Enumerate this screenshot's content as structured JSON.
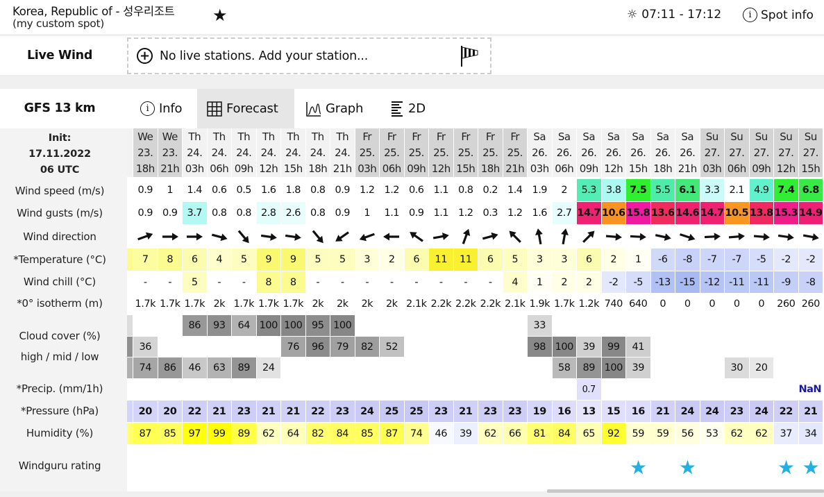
{
  "spot": {
    "title": "Korea, Republic of - 성우리조트",
    "subtitle": "(my custom spot)",
    "favorite_icon": "star-icon",
    "sun_times": "07:11 - 17:12",
    "spot_info": "Spot info"
  },
  "live_wind": {
    "label": "Live Wind",
    "message": "No live stations. Add your station..."
  },
  "model": {
    "name": "GFS 13 km"
  },
  "tabs": [
    {
      "label": "Info",
      "icon": "info-icon"
    },
    {
      "label": "Forecast",
      "icon": "grid-icon",
      "active": true
    },
    {
      "label": "Graph",
      "icon": "graph-icon"
    },
    {
      "label": "2D",
      "icon": "bars-icon"
    }
  ],
  "init": {
    "label": "Init:",
    "date": "17.11.2022",
    "time": "06 UTC"
  },
  "row_labels": {
    "wind_speed": "Wind speed (m/s)",
    "wind_gusts": "Wind gusts (m/s)",
    "wind_direction": "Wind direction",
    "temperature": "*Temperature (°C)",
    "wind_chill": "Wind chill (°C)",
    "isotherm": "*0° isotherm (m)",
    "cloud": "Cloud cover (%)",
    "cloud_sub": "high / mid / low",
    "precip": "*Precip. (mm/1h)",
    "pressure": "*Pressure (hPa)",
    "humidity": "Humidity (%)",
    "rating": "Windguru rating"
  },
  "columns": {
    "day": [
      "We",
      "We",
      "Th",
      "Th",
      "Th",
      "Th",
      "Th",
      "Th",
      "Th",
      "Fr",
      "Fr",
      "Fr",
      "Fr",
      "Fr",
      "Fr",
      "Fr",
      "Sa",
      "Sa",
      "Sa",
      "Sa",
      "Sa",
      "Sa",
      "Sa",
      "Su",
      "Su",
      "Su",
      "Su",
      "Su"
    ],
    "date": [
      "23.",
      "23.",
      "24.",
      "24.",
      "24.",
      "24.",
      "24.",
      "24.",
      "24.",
      "25.",
      "25.",
      "25.",
      "25.",
      "25.",
      "25.",
      "25.",
      "26.",
      "26.",
      "26.",
      "26.",
      "26.",
      "26.",
      "26.",
      "27.",
      "27.",
      "27.",
      "27.",
      "27."
    ],
    "hour": [
      "18h",
      "21h",
      "03h",
      "06h",
      "09h",
      "12h",
      "15h",
      "18h",
      "21h",
      "03h",
      "06h",
      "09h",
      "12h",
      "15h",
      "18h",
      "21h",
      "03h",
      "06h",
      "09h",
      "12h",
      "15h",
      "18h",
      "21h",
      "03h",
      "06h",
      "09h",
      "12h",
      "15h"
    ],
    "wind_speed": [
      "0.9",
      "1",
      "1.4",
      "0.6",
      "0.5",
      "1.6",
      "1.8",
      "0.8",
      "0.9",
      "1.2",
      "1.2",
      "0.6",
      "1.1",
      "0.8",
      "0.2",
      "1.4",
      "1.9",
      "2",
      "5.3",
      "3.8",
      "7.5",
      "5.5",
      "6.1",
      "3.3",
      "2.1",
      "4.9",
      "7.4",
      "6.8"
    ],
    "wind_gusts": [
      "0.9",
      "0.9",
      "3.7",
      "0.8",
      "0.8",
      "2.8",
      "2.6",
      "0.8",
      "0.9",
      "1",
      "1.1",
      "0.9",
      "1.1",
      "1.2",
      "0.3",
      "1.2",
      "1.6",
      "2.7",
      "14.7",
      "10.6",
      "15.8",
      "13.6",
      "14.6",
      "14.7",
      "10.5",
      "13.8",
      "15.3",
      "14.9"
    ],
    "wind_direction_deg": [
      250,
      270,
      270,
      285,
      320,
      278,
      278,
      320,
      55,
      70,
      90,
      125,
      260,
      200,
      255,
      135,
      170,
      190,
      225,
      275,
      273,
      282,
      288,
      267,
      265,
      275,
      278,
      280
    ],
    "temperature": [
      "7",
      "8",
      "6",
      "4",
      "5",
      "9",
      "9",
      "5",
      "5",
      "3",
      "2",
      "6",
      "11",
      "11",
      "6",
      "5",
      "3",
      "3",
      "6",
      "2",
      "1",
      "-6",
      "-8",
      "-7",
      "-7",
      "-5",
      "-2",
      "-2"
    ],
    "wind_chill": [
      "-",
      "-",
      "5",
      "-",
      "-",
      "8",
      "8",
      "-",
      "-",
      "-",
      "-",
      "-",
      "-",
      "-",
      "-",
      "4",
      "1",
      "2",
      "2",
      "-2",
      "-5",
      "-13",
      "-15",
      "-12",
      "-11",
      "-11",
      "-9",
      "-8"
    ],
    "isotherm": [
      "1.7k",
      "1.7k",
      "1.7k",
      "2k",
      "1.7k",
      "1.7k",
      "1.7k",
      "2k",
      "2k",
      "2k",
      "2k",
      "2.1k",
      "2.2k",
      "2.2k",
      "2.2k",
      "2.1k",
      "1.9k",
      "1.7k",
      "1.2k",
      "740",
      "640",
      "0",
      "0",
      "0",
      "0",
      "0",
      "260",
      "260"
    ],
    "cloud_high": [
      "",
      "",
      "86",
      "93",
      "64",
      "100",
      "100",
      "95",
      "100",
      "",
      "",
      "",
      "",
      "",
      "",
      "",
      "33",
      "",
      "",
      "",
      "",
      "",
      "",
      "",
      "",
      "",
      "",
      ""
    ],
    "cloud_mid": [
      "36",
      "",
      "",
      "",
      "",
      "",
      "76",
      "96",
      "79",
      "82",
      "52",
      "",
      "",
      "",
      "",
      "",
      "98",
      "100",
      "39",
      "99",
      "41",
      "",
      "",
      "",
      "",
      "",
      "",
      ""
    ],
    "cloud_low": [
      "74",
      "86",
      "46",
      "63",
      "89",
      "24",
      "",
      "",
      "",
      "",
      "",
      "",
      "",
      "",
      "",
      "",
      "",
      "58",
      "89",
      "100",
      "39",
      "",
      "",
      "",
      "30",
      "20",
      "",
      ""
    ],
    "precip": [
      "",
      "",
      "",
      "",
      "",
      "",
      "",
      "",
      "",
      "",
      "",
      "",
      "",
      "",
      "",
      "",
      "",
      "",
      "0.7",
      "",
      "",
      "",
      "",
      "",
      "",
      "",
      "",
      "NaN"
    ],
    "pressure": [
      "20",
      "20",
      "22",
      "21",
      "23",
      "21",
      "21",
      "22",
      "23",
      "24",
      "25",
      "25",
      "23",
      "21",
      "23",
      "23",
      "19",
      "16",
      "13",
      "15",
      "16",
      "21",
      "24",
      "24",
      "23",
      "24",
      "22",
      "21"
    ],
    "humidity": [
      "87",
      "85",
      "97",
      "99",
      "89",
      "62",
      "64",
      "82",
      "84",
      "85",
      "87",
      "74",
      "46",
      "39",
      "62",
      "66",
      "81",
      "84",
      "65",
      "92",
      "59",
      "59",
      "56",
      "53",
      "62",
      "62",
      "37",
      "34"
    ],
    "rating_stars": [
      0,
      0,
      0,
      0,
      0,
      0,
      0,
      0,
      0,
      0,
      0,
      0,
      0,
      0,
      0,
      0,
      0,
      0,
      0,
      0,
      1,
      0,
      1,
      0,
      0,
      0,
      1,
      1
    ]
  },
  "colors": {
    "rating_star": "#22b0e0",
    "nan_text": "#1a1aa0",
    "active_tab": "#e6e6e6",
    "day_dark": "#d4d4d4",
    "day_light": "#f2f2f2"
  }
}
